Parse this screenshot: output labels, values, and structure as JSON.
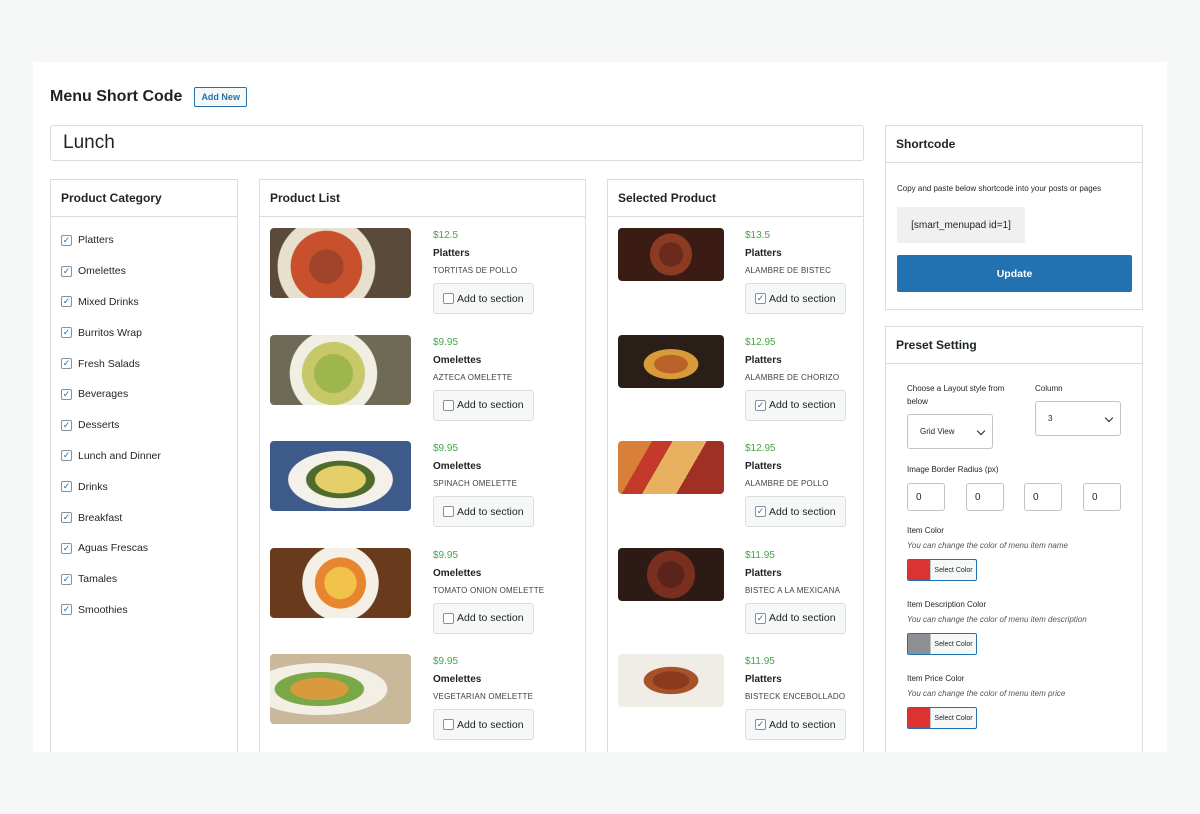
{
  "header": {
    "title": "Menu Short Code",
    "add_new": "Add New"
  },
  "menu_title": "Lunch",
  "category_panel": {
    "title": "Product Category",
    "items": [
      "Platters",
      "Omelettes",
      "Mixed Drinks",
      "Burritos Wrap",
      "Fresh Salads",
      "Beverages",
      "Desserts",
      "Lunch and Dinner",
      "Drinks",
      "Breakfast",
      "Aguas Frescas",
      "Tamales",
      "Smoothies"
    ]
  },
  "product_list": {
    "title": "Product List",
    "add_label": "Add to section",
    "items": [
      {
        "price": "$12.5",
        "category": "Platters",
        "name": "TORTITAS DE POLLO",
        "checked": false
      },
      {
        "price": "$9.95",
        "category": "Omelettes",
        "name": "AZTECA OMELETTE",
        "checked": false
      },
      {
        "price": "$9.95",
        "category": "Omelettes",
        "name": "SPINACH OMELETTE",
        "checked": false
      },
      {
        "price": "$9.95",
        "category": "Omelettes",
        "name": "TOMATO ONION OMELETTE",
        "checked": false
      },
      {
        "price": "$9.95",
        "category": "Omelettes",
        "name": "VEGETARIAN OMELETTE",
        "checked": false
      }
    ]
  },
  "selected_list": {
    "title": "Selected Product",
    "add_label": "Add to section",
    "items": [
      {
        "price": "$13.5",
        "category": "Platters",
        "name": "ALAMBRE DE BISTEC",
        "checked": true
      },
      {
        "price": "$12.95",
        "category": "Platters",
        "name": "ALAMBRE DE CHORIZO",
        "checked": true
      },
      {
        "price": "$12.95",
        "category": "Platters",
        "name": "ALAMBRE DE POLLO",
        "checked": true
      },
      {
        "price": "$11.95",
        "category": "Platters",
        "name": "BISTEC A LA MEXICANA",
        "checked": true
      },
      {
        "price": "$11.95",
        "category": "Platters",
        "name": "BISTECK ENCEBOLLADO",
        "checked": true
      }
    ]
  },
  "shortcode": {
    "title": "Shortcode",
    "description": "Copy and paste below shortcode into your posts or pages",
    "code": "[smart_menupad id=1]",
    "update_label": "Update"
  },
  "preset": {
    "title": "Preset Setting",
    "layout_label": "Choose a Layout style from below",
    "layout_value": "Grid View",
    "column_label": "Column",
    "column_value": "3",
    "radius_label": "Image Border Radius (px)",
    "radius_values": [
      "0",
      "0",
      "0",
      "0"
    ],
    "select_color_label": "Select Color",
    "item_color": {
      "label": "Item Color",
      "help": "You can change the color of menu item name",
      "value": "#dc3232"
    },
    "desc_color": {
      "label": "Item Description Color",
      "help": "You can change the color of menu item description",
      "value": "#8c8f94"
    },
    "price_color": {
      "label": "Item Price Color",
      "help": "You can change the color of menu item price",
      "value": "#dc3232"
    }
  },
  "icons": {
    "checked": "checkmark-icon",
    "dropdown": "chevron-down-icon"
  }
}
